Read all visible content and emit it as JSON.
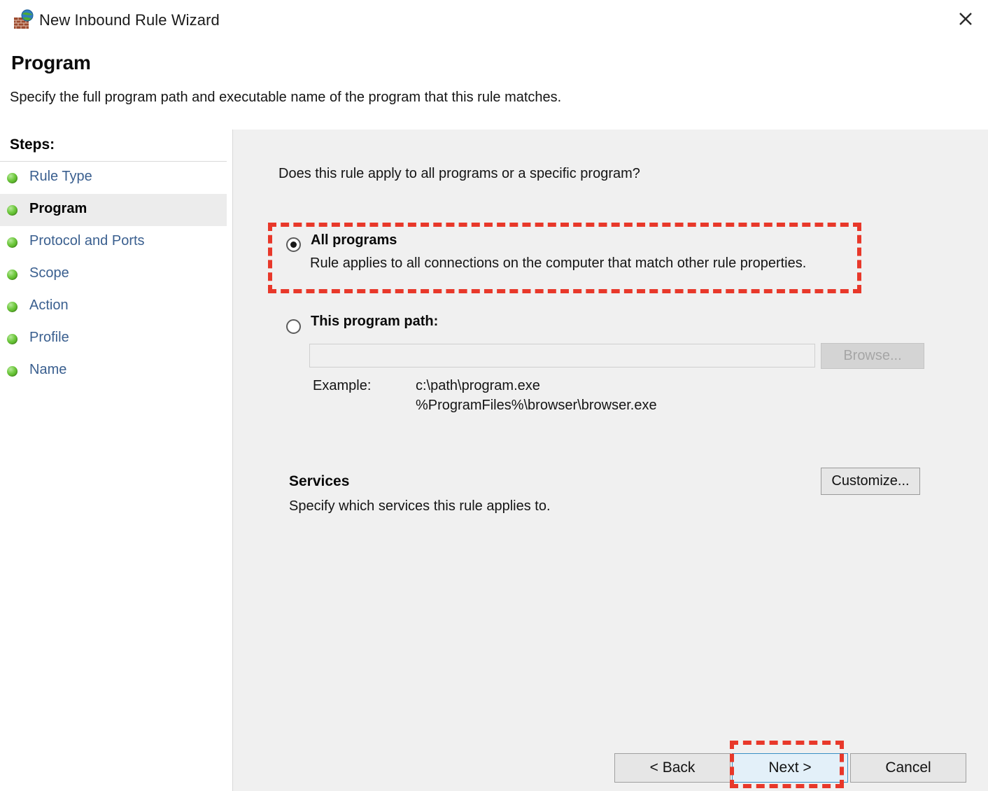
{
  "window": {
    "title": "New Inbound Rule Wizard",
    "icon": "firewall-globe-icon",
    "close_label": "✕"
  },
  "header": {
    "title": "Program",
    "subtitle": "Specify the full program path and executable name of the program that this rule matches."
  },
  "sidebar": {
    "heading": "Steps:",
    "items": [
      {
        "label": "Rule Type",
        "current": false
      },
      {
        "label": "Program",
        "current": true
      },
      {
        "label": "Protocol and Ports",
        "current": false
      },
      {
        "label": "Scope",
        "current": false
      },
      {
        "label": "Action",
        "current": false
      },
      {
        "label": "Profile",
        "current": false
      },
      {
        "label": "Name",
        "current": false
      }
    ]
  },
  "main": {
    "question": "Does this rule apply to all programs or a specific program?",
    "option_all": {
      "label": "All programs",
      "description": "Rule applies to all connections on the computer that match other rule properties.",
      "selected": true
    },
    "option_path": {
      "label": "This program path:",
      "selected": false,
      "input_value": "",
      "input_placeholder": "",
      "browse_label": "Browse...",
      "browse_enabled": false
    },
    "example": {
      "label": "Example:",
      "line1": "c:\\path\\program.exe",
      "line2": "%ProgramFiles%\\browser\\browser.exe"
    },
    "services": {
      "title": "Services",
      "description": "Specify which services this rule applies to.",
      "customize_label": "Customize..."
    }
  },
  "footer": {
    "back_label": "< Back",
    "next_label": "Next >",
    "cancel_label": "Cancel"
  },
  "annotations": {
    "accent_color": "#e8382a",
    "boxes": [
      {
        "target": "all-programs-option"
      },
      {
        "target": "next-button"
      }
    ]
  }
}
